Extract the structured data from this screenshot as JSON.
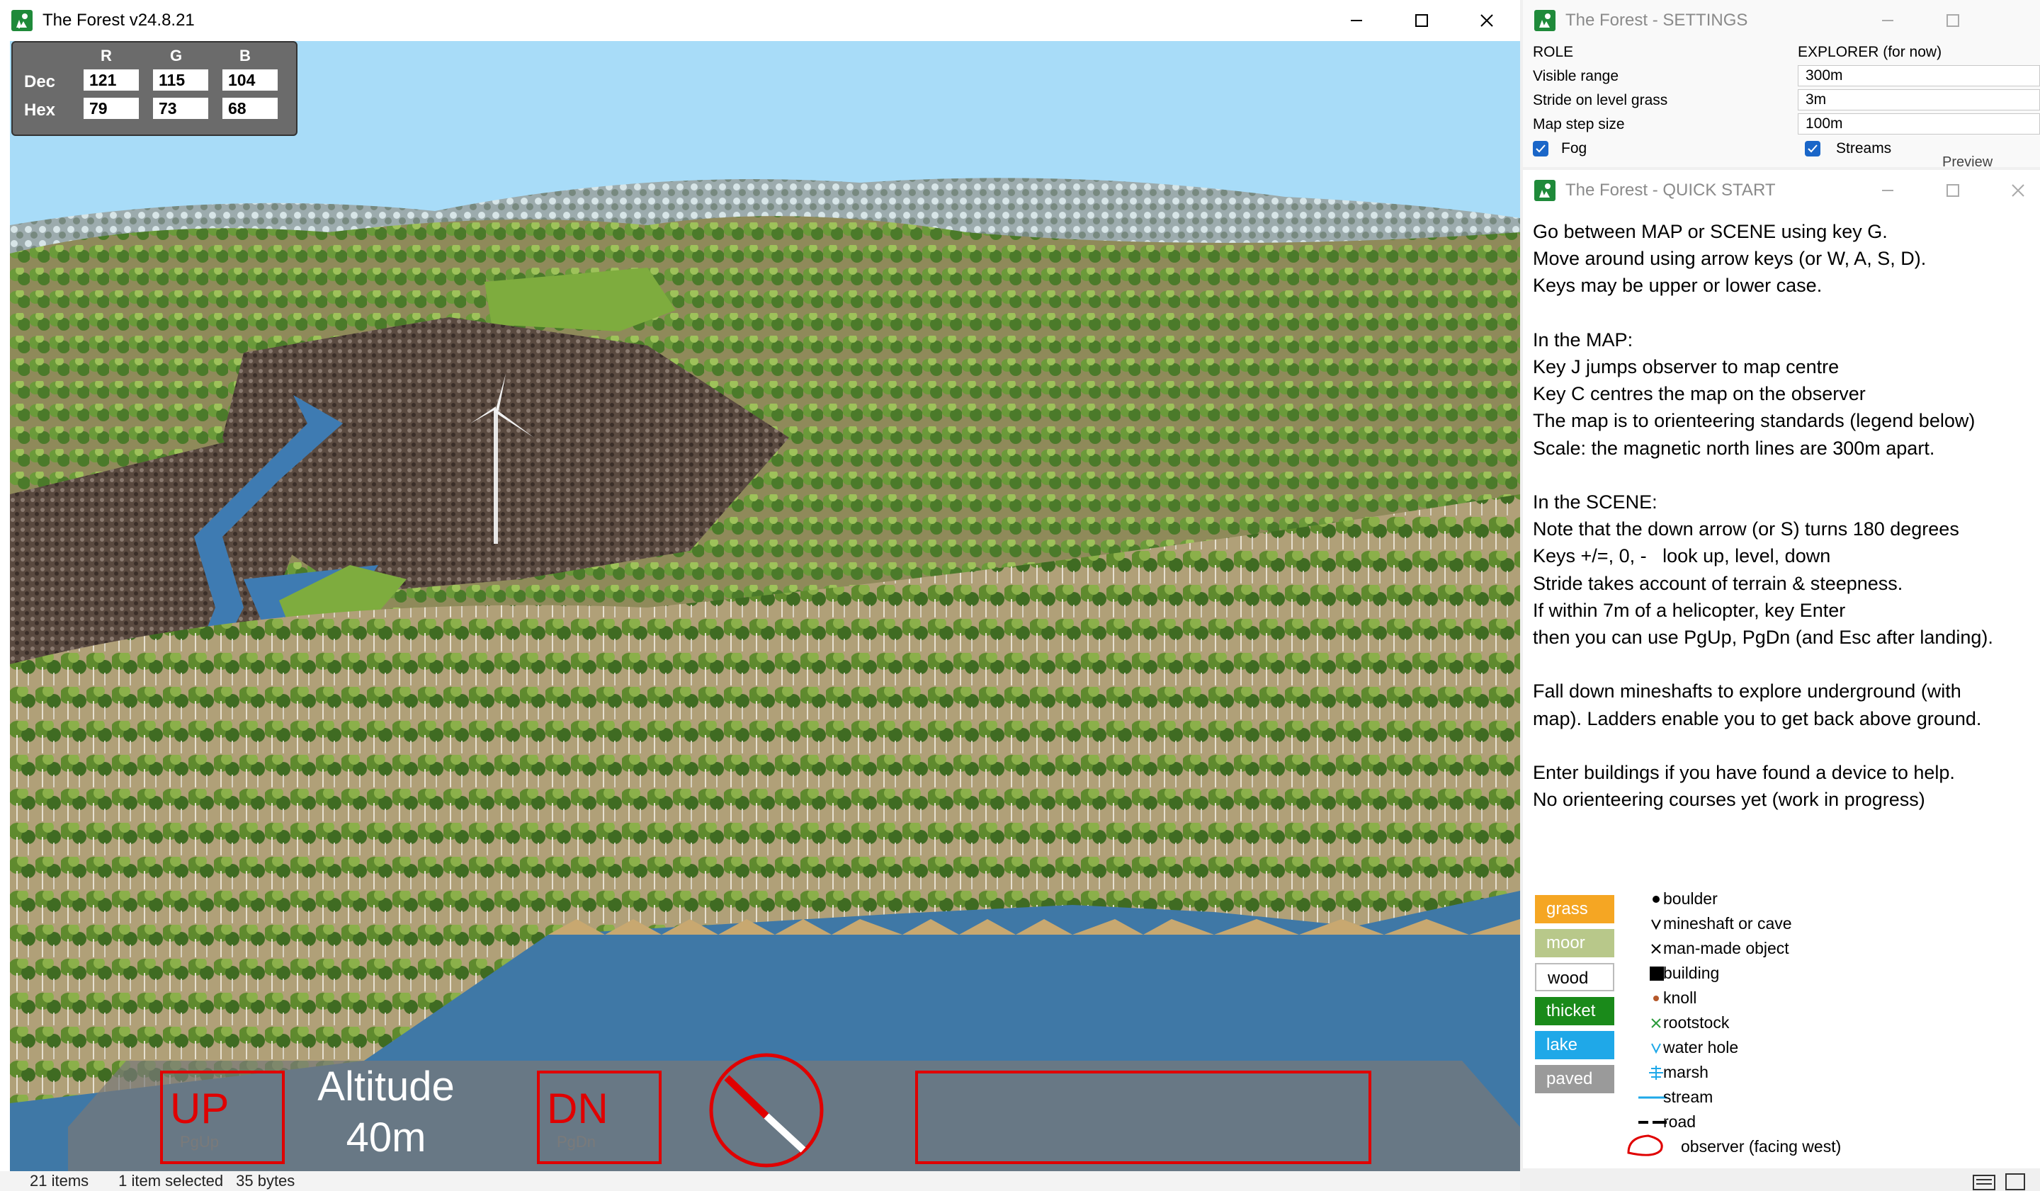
{
  "main_window": {
    "title": "The Forest v24.8.21",
    "rgb_panel": {
      "headers": [
        "R",
        "G",
        "B"
      ],
      "dec_label": "Dec",
      "hex_label": "Hex",
      "dec_values": [
        "121",
        "115",
        "104"
      ],
      "hex_values": [
        "79",
        "73",
        "68"
      ]
    },
    "hud": {
      "up_label": "UP",
      "up_key": "PgUp",
      "altitude_label": "Altitude",
      "altitude_value": "40m",
      "down_label": "DN",
      "down_key": "PgDn",
      "message": ""
    }
  },
  "status_bar": {
    "items": "21 items",
    "selected": "1 item selected",
    "size": "35 bytes"
  },
  "settings_window": {
    "title": "The Forest - SETTINGS",
    "rows": [
      {
        "label": "ROLE",
        "value": "EXPLORER (for now)"
      },
      {
        "label": "Visible range",
        "value": "300m"
      },
      {
        "label": "Stride on level grass",
        "value": "3m"
      },
      {
        "label": "Map step size",
        "value": "100m"
      }
    ],
    "fog_label": "Fog",
    "streams_label": "Streams",
    "preview_label": "Preview"
  },
  "quick_start_window": {
    "title": "The Forest - QUICK START",
    "lines": [
      "Go between MAP or SCENE using key G.",
      "Move around using arrow keys (or W, A, S, D).",
      "Keys may be upper or lower case.",
      "",
      "In the MAP:",
      "Key J jumps observer to map centre",
      "Key C centres the map on the observer",
      "The map is to orienteering standards (legend below)",
      "Scale: the magnetic north lines are 300m apart.",
      "",
      "In the SCENE:",
      "Note that the down arrow (or S) turns 180 degrees",
      "Keys +/=, 0, -   look up, level, down",
      "Stride takes account of terrain & steepness.",
      "If within 7m of a helicopter, key Enter",
      "then you can use PgUp, PgDn (and Esc after landing).",
      "",
      "Fall down mineshafts to explore underground (with",
      "map). Ladders enable you to get back above ground.",
      "",
      "Enter buildings if you have found a device to help.",
      "No orienteering courses yet (work in progress)"
    ],
    "legend": {
      "terrain": [
        {
          "label": "grass",
          "color": "#f5a623",
          "text_color": "#ffffff"
        },
        {
          "label": "moor",
          "color": "#b8c88a",
          "text_color": "#ffffff"
        },
        {
          "label": "wood",
          "color": "#ffffff",
          "text_color": "#000000"
        },
        {
          "label": "thicket",
          "color": "#1a8a1a",
          "text_color": "#ffffff"
        },
        {
          "label": "lake",
          "color": "#1fa8e8",
          "text_color": "#ffffff"
        },
        {
          "label": "paved",
          "color": "#9a9a9a",
          "text_color": "#ffffff"
        }
      ],
      "symbols": [
        {
          "label": "boulder",
          "icon": "dot-icon"
        },
        {
          "label": "mineshaft or cave",
          "icon": "v-icon"
        },
        {
          "label": "man-made object",
          "icon": "x-icon"
        },
        {
          "label": "building",
          "icon": "square-icon"
        },
        {
          "label": "knoll",
          "icon": "brown-dot-icon"
        },
        {
          "label": "rootstock",
          "icon": "green-x-icon"
        },
        {
          "label": "water hole",
          "icon": "blue-v-icon"
        },
        {
          "label": "marsh",
          "icon": "marsh-icon"
        },
        {
          "label": "stream",
          "icon": "stream-icon"
        },
        {
          "label": "road",
          "icon": "road-icon"
        },
        {
          "label": "observer (facing west)",
          "icon": "observer-icon"
        }
      ]
    }
  }
}
